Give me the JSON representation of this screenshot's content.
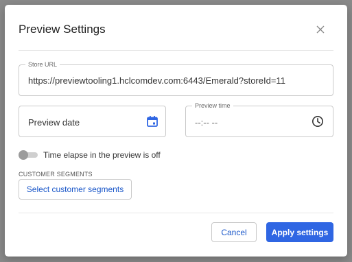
{
  "dialog": {
    "title": "Preview Settings",
    "close_icon": "close-icon"
  },
  "store_url": {
    "label": "Store URL",
    "value": "https://previewtooling1.hclcomdev.com:6443/Emerald?storeId=11"
  },
  "preview_date": {
    "placeholder": "Preview date",
    "icon": "calendar-icon",
    "icon_color": "#2f66e3"
  },
  "preview_time": {
    "label": "Preview time",
    "value": "--:-- --",
    "icon": "clock-icon"
  },
  "time_elapse": {
    "label": "Time elapse in the preview is off",
    "enabled": false
  },
  "customer_segments": {
    "section_label": "CUSTOMER SEGMENTS",
    "button_label": "Select customer segments"
  },
  "actions": {
    "cancel_label": "Cancel",
    "apply_label": "Apply settings",
    "accent": "#2f66e3"
  }
}
